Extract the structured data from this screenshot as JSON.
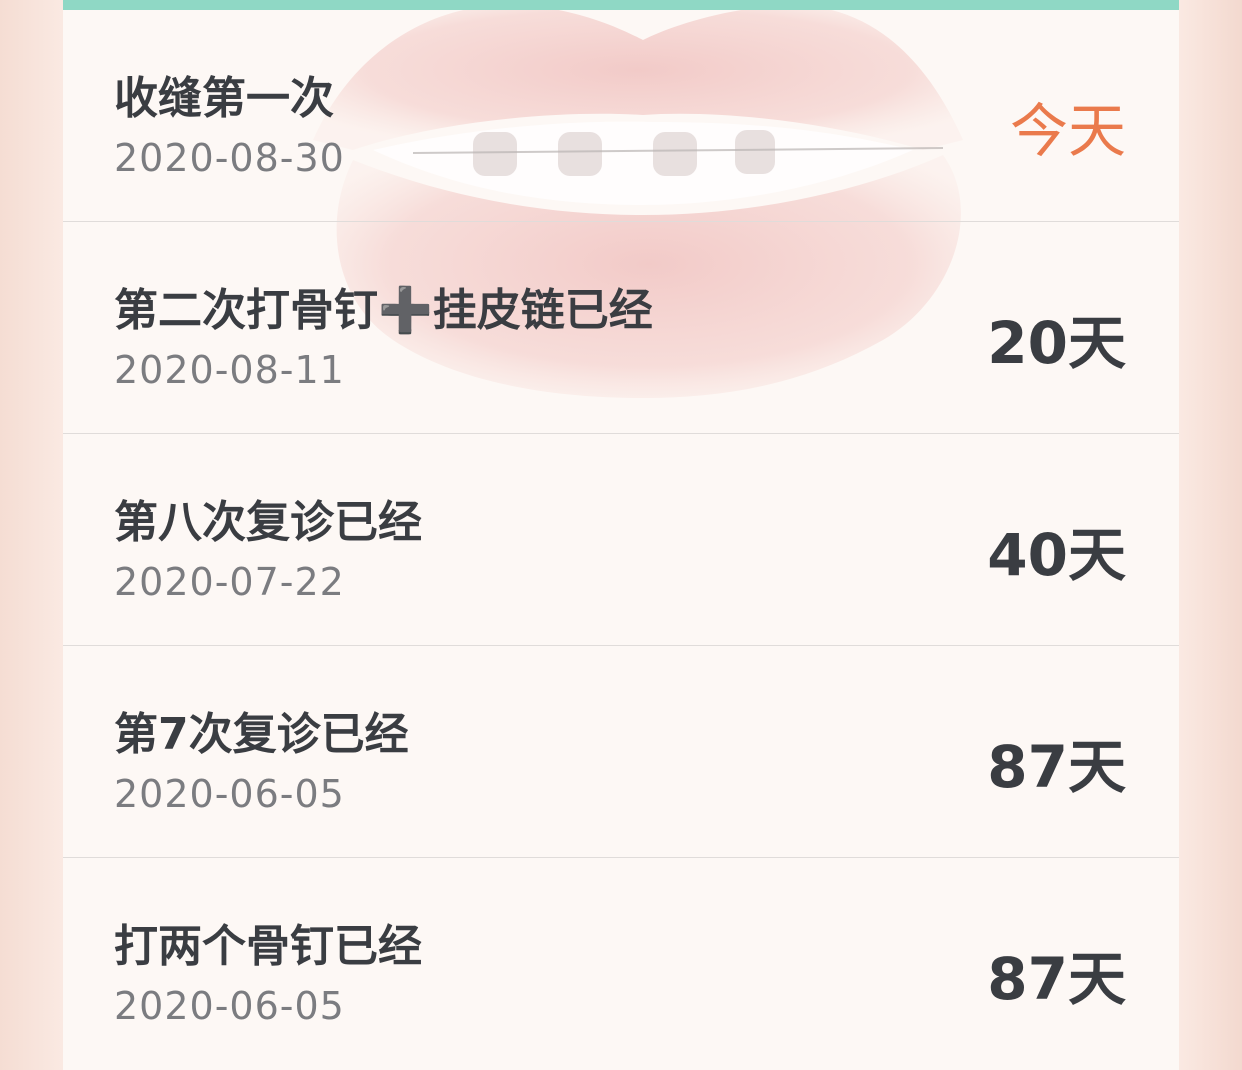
{
  "theme": {
    "accent_bar": "#8fd8c5",
    "today_color": "#ea7a4c",
    "text_dark": "#3a3d42",
    "text_muted": "#7b7c80"
  },
  "events": [
    {
      "title": "收缝第一次",
      "date": "2020-08-30",
      "days": "今天",
      "is_today": true
    },
    {
      "title": "第二次打骨钉➕挂皮链已经",
      "date": "2020-08-11",
      "days": "20天",
      "is_today": false
    },
    {
      "title": "第八次复诊已经",
      "date": "2020-07-22",
      "days": "40天",
      "is_today": false
    },
    {
      "title": "第7次复诊已经",
      "date": "2020-06-05",
      "days": "87天",
      "is_today": false
    },
    {
      "title": "打两个骨钉已经",
      "date": "2020-06-05",
      "days": "87天",
      "is_today": false
    }
  ]
}
